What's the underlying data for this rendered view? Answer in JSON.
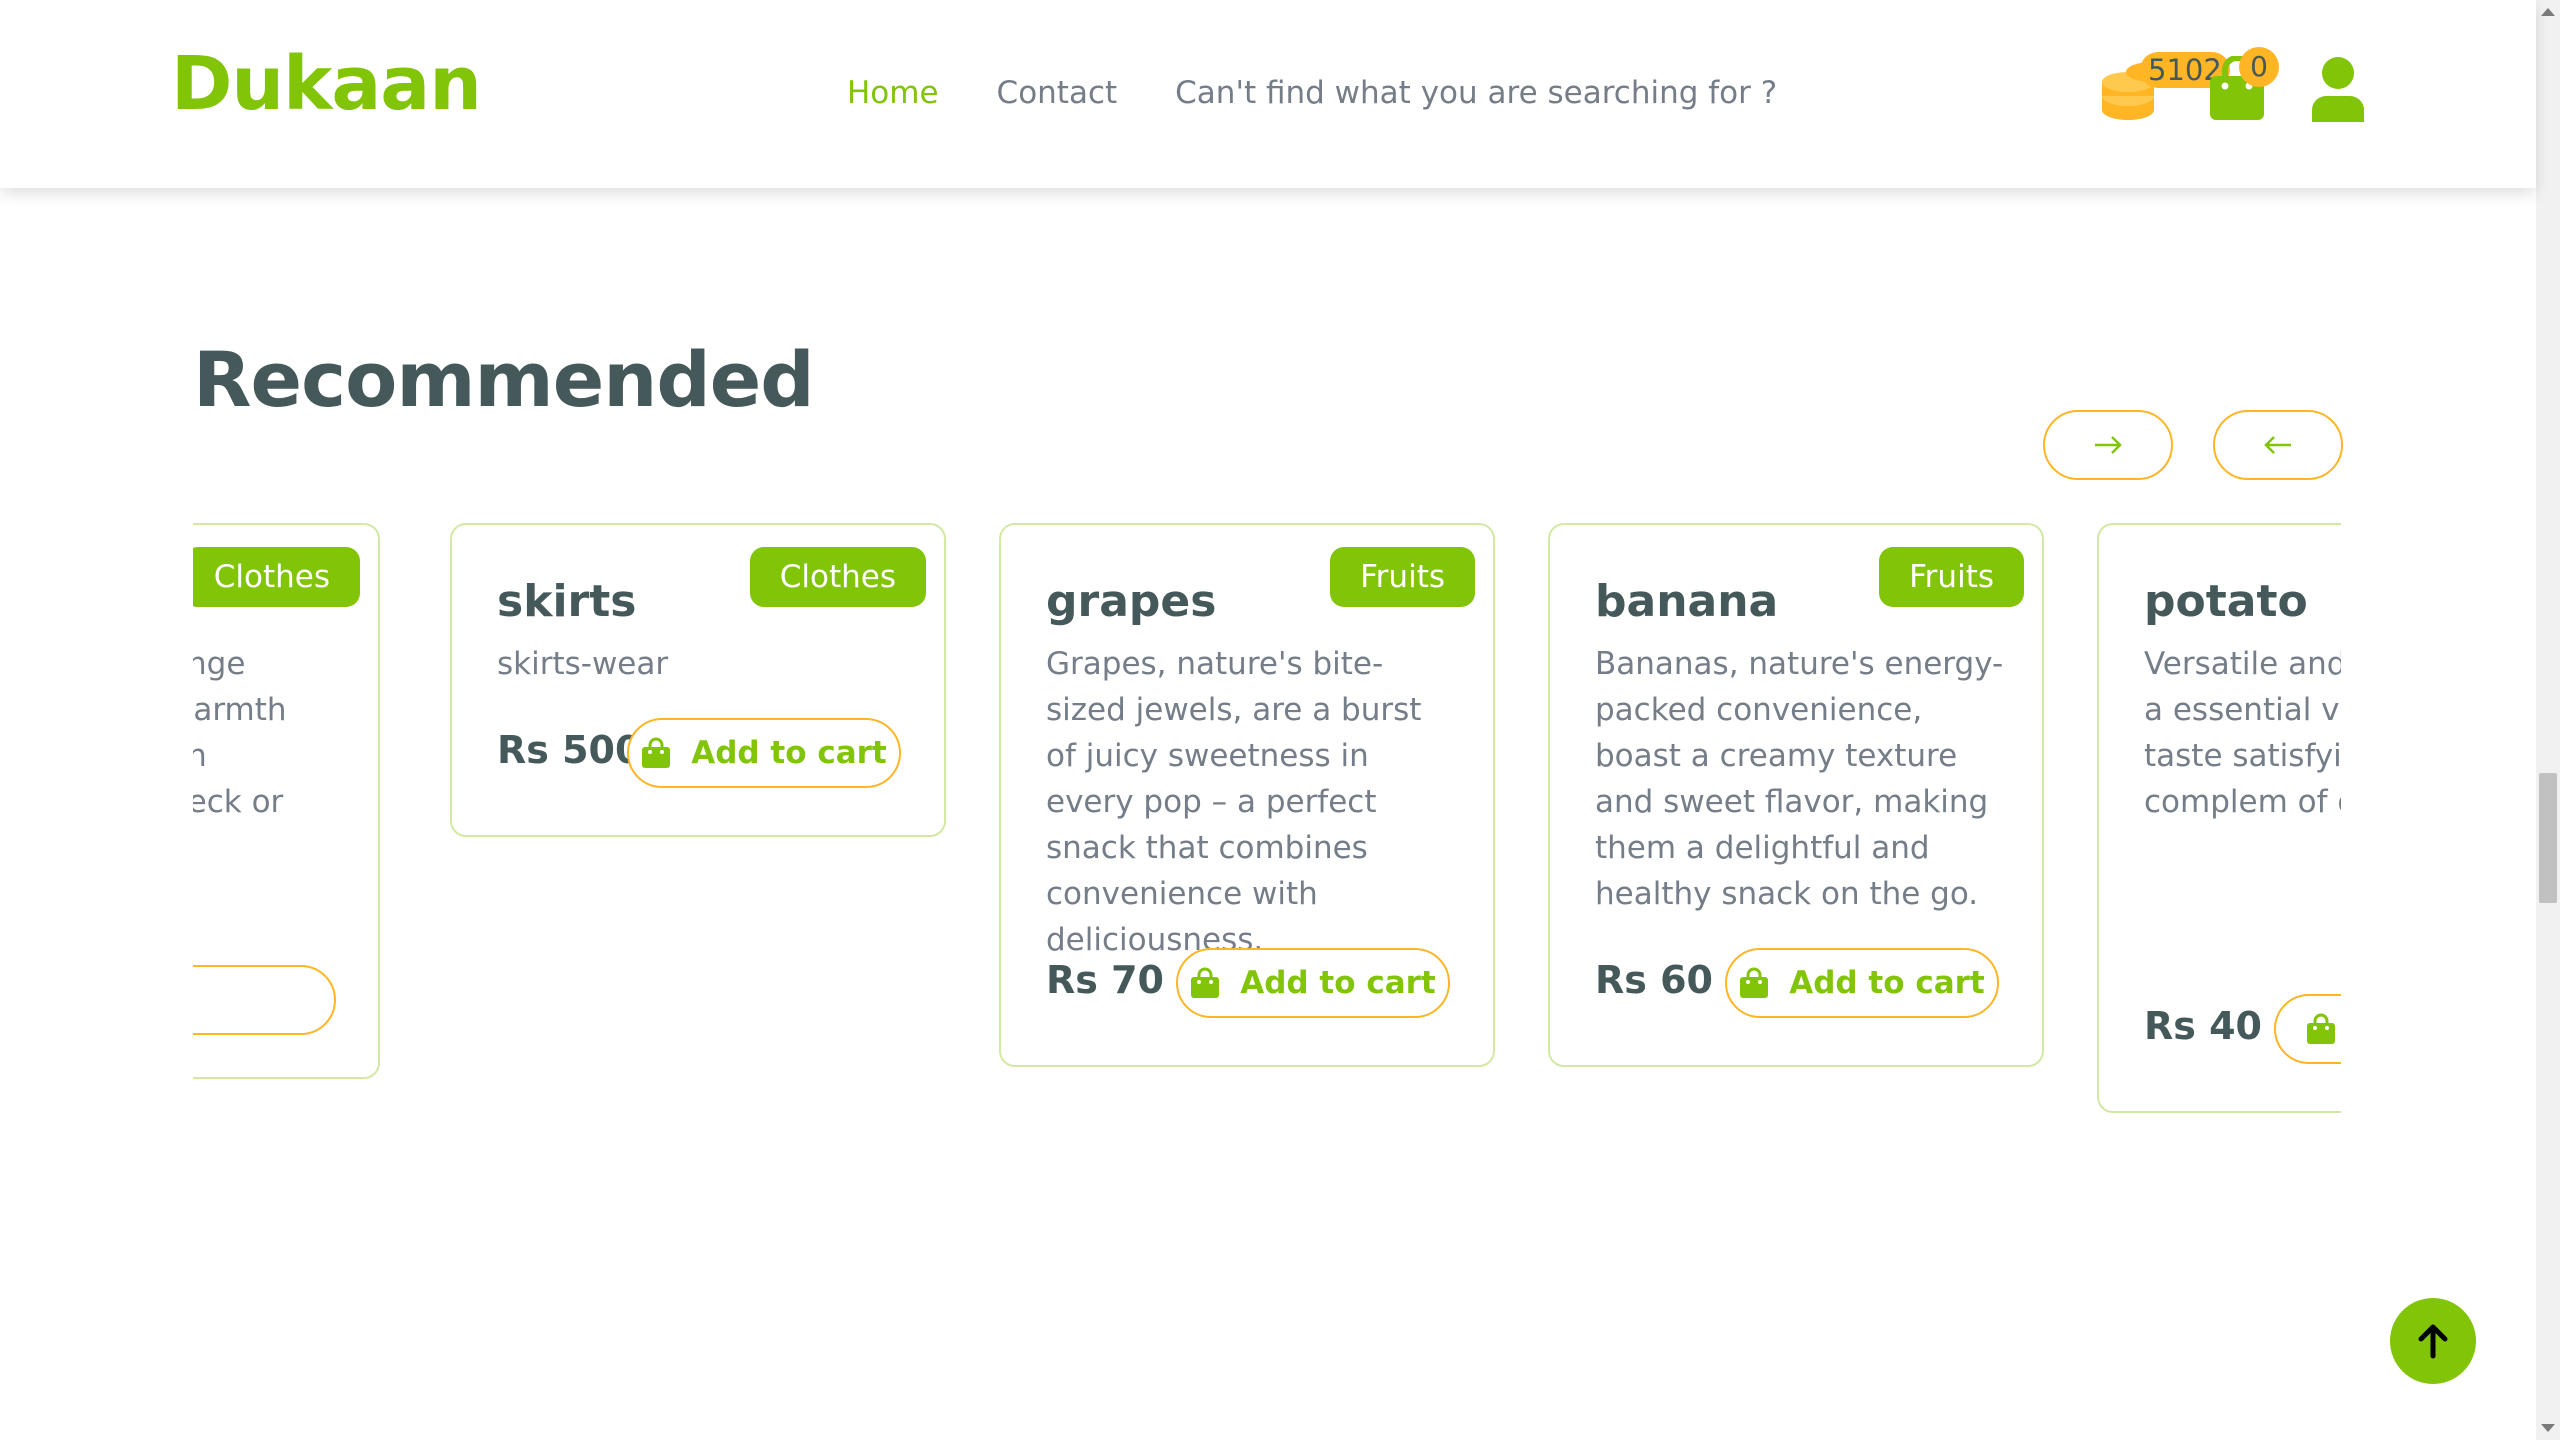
{
  "header": {
    "logo": "Dukaan",
    "nav": [
      {
        "label": "Home",
        "active": true
      },
      {
        "label": "Contact",
        "active": false
      },
      {
        "label": "Can't find what you are searching for ?",
        "active": false
      }
    ],
    "coins_count": "5102",
    "cart_count": "0",
    "icons": {
      "coins": "coins-icon",
      "cart": "shopping-bag-icon",
      "user": "user-icon"
    }
  },
  "section": {
    "title": "Recommended",
    "next_icon": "arrow-right-icon",
    "prev_icon": "arrow-left-icon"
  },
  "products": [
    {
      "category": "Clothes",
      "name": "",
      "description": "range warmth en neck or",
      "price": "",
      "cart_label": ""
    },
    {
      "category": "Clothes",
      "name": "skirts",
      "description": "skirts-wear",
      "price": "Rs 500",
      "cart_label": "Add to cart"
    },
    {
      "category": "Fruits",
      "name": "grapes",
      "description": "Grapes, nature's bite-sized jewels, are a burst of juicy sweetness in every pop – a perfect snack that combines convenience with deliciousness.",
      "price": "Rs 70",
      "cart_label": "Add to cart"
    },
    {
      "category": "Fruits",
      "name": "banana",
      "description": "Bananas, nature's energy-packed convenience, boast a creamy texture and sweet flavor, making them a delightful and healthy snack on the go.",
      "price": "Rs 60",
      "cart_label": "Add to cart"
    },
    {
      "category": "",
      "name": "potato",
      "description": "Versatile and the potato is a essential vege a neutral taste satisfying, star that complem of dishes.",
      "price": "Rs 40",
      "cart_label": ""
    }
  ],
  "colors": {
    "brand": "#81c408",
    "accent": "#ffb524",
    "text": "#45595b",
    "muted": "#747d88"
  }
}
